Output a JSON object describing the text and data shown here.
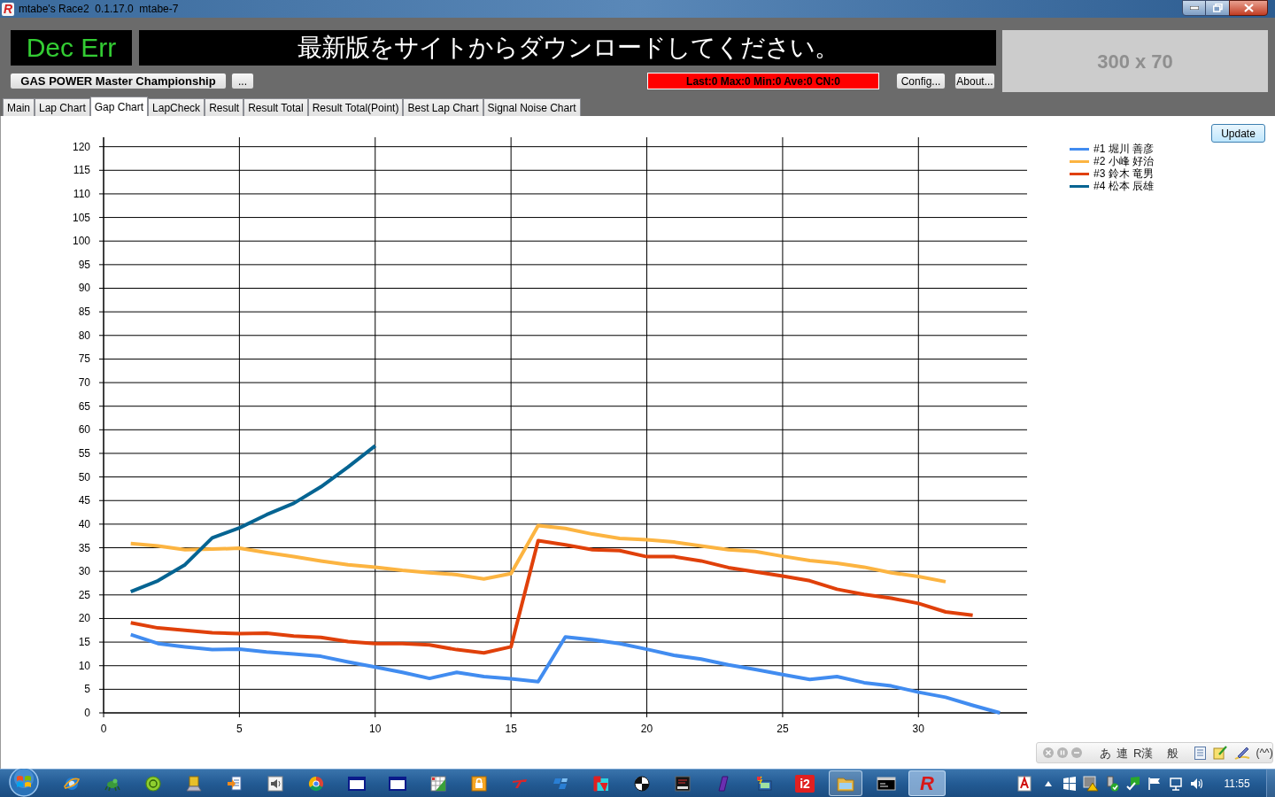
{
  "window": {
    "logo": "R",
    "title": "mtabe's Race2  0.1.17.0  mtabe-7"
  },
  "header": {
    "status_display": "Dec Err",
    "message": "最新版をサイトからダウンロードしてください。",
    "ad_banner": "300 x 70",
    "event_button": "GAS POWER Master Championship",
    "more_button": "...",
    "stats": "Last:0 Max:0 Min:0 Ave:0 CN:0",
    "config_button": "Config...",
    "about_button": "About..."
  },
  "tabs": [
    {
      "label": "Main",
      "selected": false
    },
    {
      "label": "Lap Chart",
      "selected": false
    },
    {
      "label": "Gap Chart",
      "selected": true
    },
    {
      "label": "LapCheck",
      "selected": false
    },
    {
      "label": "Result",
      "selected": false
    },
    {
      "label": "Result Total",
      "selected": false
    },
    {
      "label": "Result Total(Point)",
      "selected": false
    },
    {
      "label": "Best Lap Chart",
      "selected": false
    },
    {
      "label": "Signal Noise Chart",
      "selected": false
    }
  ],
  "gap_chart": {
    "update_button": "Update",
    "chart_data": {
      "type": "line",
      "grid": true,
      "x": [
        1,
        2,
        3,
        4,
        5,
        6,
        7,
        8,
        9,
        10,
        11,
        12,
        13,
        14,
        15,
        16,
        17,
        18,
        19,
        20,
        21,
        22,
        23,
        24,
        25,
        26,
        27,
        28,
        29,
        30,
        31,
        32,
        33
      ],
      "xlim": [
        0,
        34
      ],
      "ylim": [
        0,
        122
      ],
      "xticks": [
        0,
        5,
        10,
        15,
        20,
        25,
        30
      ],
      "yticks": [
        0,
        5,
        10,
        15,
        20,
        25,
        30,
        35,
        40,
        45,
        50,
        55,
        60,
        65,
        70,
        75,
        80,
        85,
        90,
        95,
        100,
        105,
        110,
        115,
        120
      ],
      "series": [
        {
          "name": "#1 堀川 善彦",
          "color": "#418cf0",
          "values": [
            16.6,
            14.7,
            14.0,
            13.4,
            13.5,
            12.9,
            12.5,
            12.0,
            10.8,
            9.7,
            8.6,
            7.3,
            8.6,
            7.7,
            7.2,
            6.6,
            16.1,
            15.5,
            14.7,
            13.5,
            12.2,
            11.4,
            10.2,
            9.2,
            8.1,
            7.1,
            7.7,
            6.4,
            5.7,
            4.4,
            3.3,
            1.6,
            0
          ]
        },
        {
          "name": "#2 小峰 好治",
          "color": "#fcb441",
          "values": [
            35.9,
            35.4,
            34.6,
            34.7,
            34.9,
            34.0,
            33.1,
            32.2,
            31.4,
            30.9,
            30.2,
            29.7,
            29.3,
            28.4,
            29.5,
            39.7,
            39.1,
            37.9,
            37.0,
            36.7,
            36.2,
            35.4,
            34.6,
            34.2,
            33.2,
            32.3,
            31.7,
            30.9,
            29.7,
            28.9,
            27.8,
            null,
            null
          ]
        },
        {
          "name": "#3 鈴木 竜男",
          "color": "#e0400a",
          "values": [
            19.1,
            18.0,
            17.5,
            17.0,
            16.8,
            16.9,
            16.3,
            16.0,
            15.1,
            14.7,
            14.7,
            14.4,
            13.4,
            12.7,
            14.0,
            36.5,
            35.6,
            34.6,
            34.4,
            33.1,
            33.1,
            32.2,
            30.8,
            29.9,
            29.0,
            28.0,
            26.2,
            25.1,
            24.3,
            23.2,
            21.4,
            20.7,
            null
          ]
        },
        {
          "name": "#4 松本 辰雄",
          "color": "#056492",
          "values": [
            25.7,
            28.0,
            31.4,
            37.1,
            39.2,
            42.0,
            44.4,
            47.9,
            52.1,
            56.6,
            null,
            null,
            null,
            null,
            null,
            null,
            null,
            null,
            null,
            null,
            null,
            null,
            null,
            null,
            null,
            null,
            null,
            null,
            null,
            null,
            null,
            null,
            null
          ]
        }
      ]
    }
  },
  "ime_bar": {
    "modes": [
      "あ",
      "連",
      "R漢",
      "般"
    ],
    "face": "(^^)"
  },
  "taskbar": {
    "apps": [
      {
        "kind": "globe",
        "running": false
      },
      {
        "kind": "frog",
        "running": false
      },
      {
        "kind": "disc",
        "running": false
      },
      {
        "kind": "laptop",
        "running": false
      },
      {
        "kind": "doc-arrow",
        "running": false
      },
      {
        "kind": "speaker",
        "running": false
      },
      {
        "kind": "wheel",
        "running": false
      },
      {
        "kind": "window",
        "running": false
      },
      {
        "kind": "window",
        "running": false
      },
      {
        "kind": "grid",
        "running": false
      },
      {
        "kind": "lock",
        "running": false
      },
      {
        "kind": "swoosh",
        "running": false
      },
      {
        "kind": "wing",
        "running": false
      },
      {
        "kind": "tile",
        "running": false
      },
      {
        "kind": "pie",
        "running": false
      },
      {
        "kind": "monitor",
        "running": false
      },
      {
        "kind": "slash",
        "running": false
      },
      {
        "kind": "computer",
        "running": false
      },
      {
        "kind": "label-tile",
        "label": "i2",
        "running": false
      },
      {
        "kind": "folder",
        "running": true
      },
      {
        "kind": "terminal",
        "running": false
      },
      {
        "kind": "logo",
        "label": "R",
        "running": true,
        "active": true
      }
    ],
    "clock": "11:55"
  }
}
